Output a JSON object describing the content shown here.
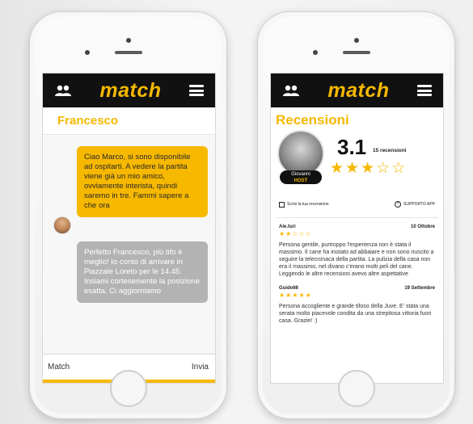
{
  "app": {
    "logo": "match"
  },
  "chat": {
    "contact_name": "Francesco",
    "incoming_message": "Ciao Marco, si sono disponibile ad ospitarti. A vedere la partita viene già un mio amico, ovviamente interista, quindi saremo in tre. Fammi sapere a che ora",
    "outgoing_message": "Perfetto Francesco, più tifo è meglio! Io conto di arrivare in Piazzale Loreto per le 14.45. Insiami cortesemente la posizione esatta. Ci aggiorniamo",
    "input_value": "Match",
    "send_label": "Invia"
  },
  "reviews": {
    "title": "Recensioni",
    "host_name": "Giovanni",
    "host_role": "HOST",
    "rating": "3.1",
    "rating_count": "15 recensioni",
    "stars_full": 3,
    "stars_total": 5,
    "write_review_label": "Scrivi la tua recensione",
    "support_label": "SUPPORTO APP",
    "items": [
      {
        "author": "Ale.turi",
        "date": "10 Ottobre",
        "stars": "★★☆☆☆",
        "text": "Persona gentile, purtroppo l'esperienza non è stata il massimo. Il cane ha iniziato ad abbaiare e non sono riuscito a seguire la telecronaca della partita. La pulizia della casa non era il massimo, nel divano c'erano molti peli del cane. Leggendo le altre recensioni avevo altre aspettative"
      },
      {
        "author": "Guido66",
        "date": "19 Settembre",
        "stars": "★★★★★",
        "text": "Persona accogliente e grande tifoso della Juve. E' stata una serata molto piacevole condita da una strepitosa vittoria fuori casa. Grazie! :)"
      }
    ]
  },
  "colors": {
    "brand_yellow": "#f5b800",
    "bar_black": "#111111",
    "outgoing_gray": "#b3b3b3"
  }
}
